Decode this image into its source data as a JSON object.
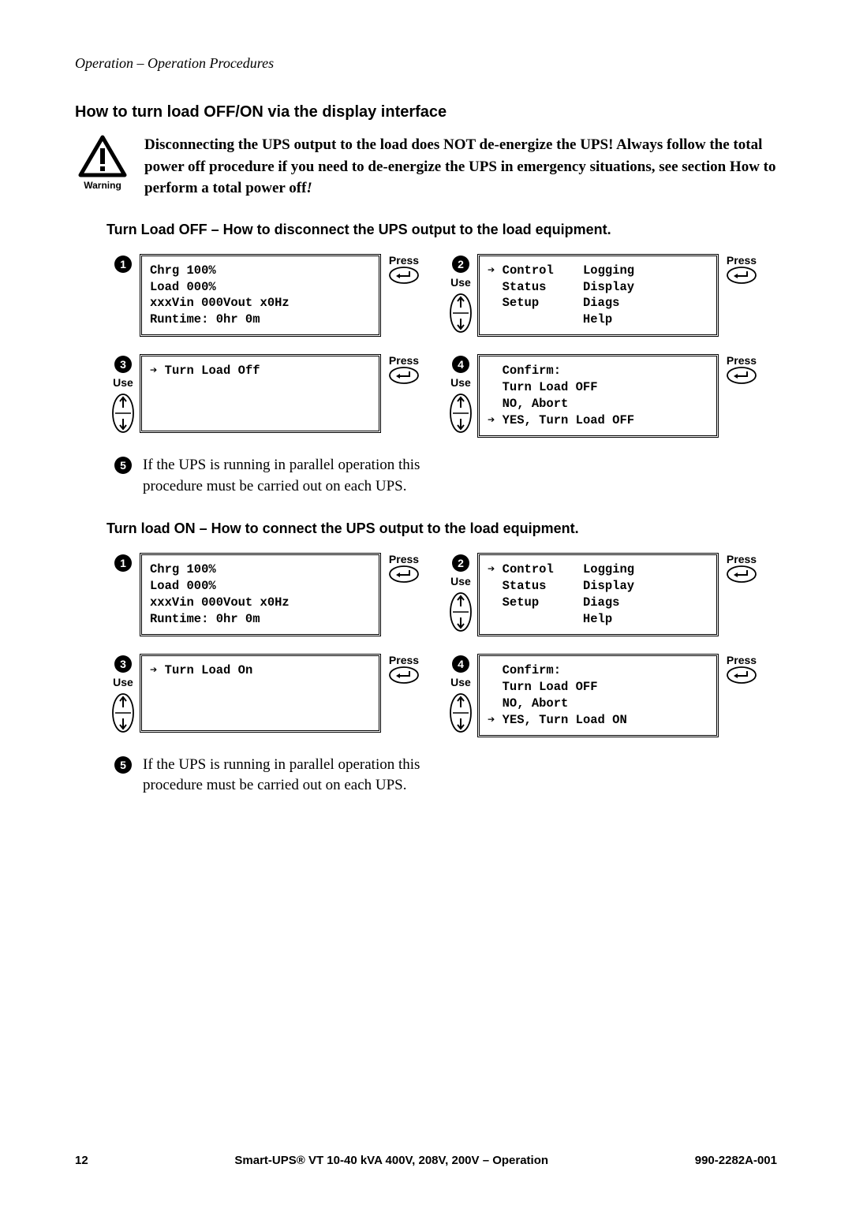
{
  "breadcrumb": "Operation – Operation Procedures",
  "title": "How to turn load OFF/ON via the display interface",
  "warning": {
    "label": "Warning",
    "text_a": "Disconnecting the UPS output to the load does NOT de-energize the UPS! Always follow the total power off procedure if you need to de-energize the UPS in emergency situations, see section How to perform a total power off",
    "text_b": "!"
  },
  "labels": {
    "use": "Use",
    "press": "Press"
  },
  "off": {
    "heading": "Turn Load OFF – How to disconnect the UPS output to the load equipment.",
    "lcd1": "Chrg 100%\nLoad 000%\nxxxVin 000Vout x0Hz\nRuntime: 0hr 0m",
    "lcd2_l1": "Control",
    "lcd2_l2": "Status",
    "lcd2_l3": "Setup",
    "lcd2_r1": "Logging",
    "lcd2_r2": "Display",
    "lcd2_r3": "Diags",
    "lcd2_r4": "Help",
    "lcd3": "Turn Load Off",
    "lcd4_l1": "Confirm:",
    "lcd4_l2": "Turn Load OFF",
    "lcd4_l3": "NO, Abort",
    "lcd4_l4": "YES, Turn Load OFF",
    "note": "If the UPS is running in parallel operation this procedure must be carried out on each UPS."
  },
  "on": {
    "heading": "Turn load ON – How to connect the UPS output to the load equipment.",
    "lcd1": "Chrg 100%\nLoad 000%\nxxxVin 000Vout x0Hz\nRuntime: 0hr 0m",
    "lcd2_l1": "Control",
    "lcd2_l2": "Status",
    "lcd2_l3": "Setup",
    "lcd2_r1": "Logging",
    "lcd2_r2": "Display",
    "lcd2_r3": "Diags",
    "lcd2_r4": "Help",
    "lcd3": "Turn Load On",
    "lcd4_l1": "Confirm:",
    "lcd4_l2": "Turn Load OFF",
    "lcd4_l3": "NO, Abort",
    "lcd4_l4": "YES, Turn Load ON",
    "note": "If the UPS is running in parallel operation this procedure must be carried out on each UPS."
  },
  "footer": {
    "page": "12",
    "center": "Smart-UPS® VT 10-40 kVA 400V, 208V, 200V – Operation",
    "right": "990-2282A-001"
  }
}
